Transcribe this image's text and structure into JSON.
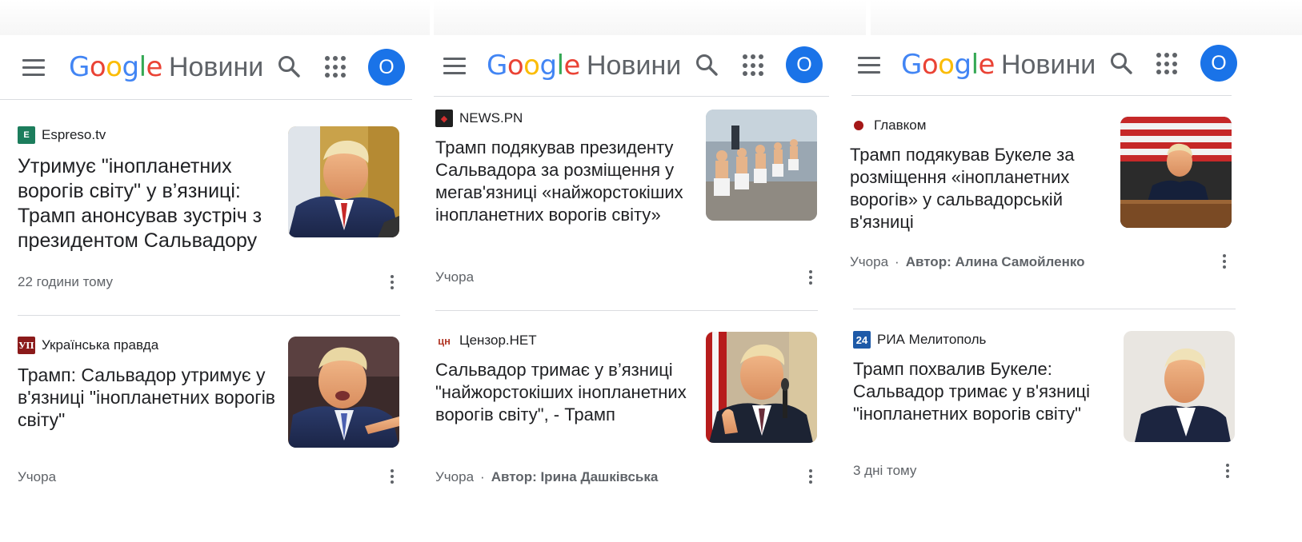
{
  "colors": {
    "g_blue": "#4285F4",
    "g_red": "#EA4335",
    "g_yellow": "#FBBC05",
    "g_green": "#34A853",
    "avatar": "#1a73e8",
    "text_primary": "#202124",
    "text_secondary": "#5f6368",
    "divider": "#dadce0"
  },
  "app": {
    "logo_letters": [
      "G",
      "o",
      "o",
      "g",
      "l",
      "e"
    ],
    "product": "Новини",
    "avatar_letter": "O",
    "icons": [
      "menu-icon",
      "search-icon",
      "apps-grid-icon"
    ]
  },
  "panels": [
    {
      "articles": [
        {
          "source": "Espreso.tv",
          "source_icon": "espreso-logo-icon",
          "headline": "Утримує \"інопланетних ворогів світу\" у в’язниці: Трамп анонсував зустріч з президентом Сальвадору",
          "time": "22 години тому",
          "author": "",
          "image": "donald-trump-photo"
        },
        {
          "source": "Українська правда",
          "source_icon": "pravda-logo-icon",
          "headline": "Трамп: Сальвадор утримує у в'язниці \"інопланетних ворогів світу\"",
          "time": "Учора",
          "author": "",
          "image": "donald-trump-photo"
        }
      ]
    },
    {
      "articles": [
        {
          "source": "NEWS.PN",
          "source_icon": "newspn-logo-icon",
          "headline": "Трамп подякував президенту Сальвадора за розміщення у мегав'язниці «найжорстокіших інопланетних ворогів світу»",
          "time": "Учора",
          "author": "",
          "image": "prisoners-photo"
        },
        {
          "source": "Цензор.НЕТ",
          "source_icon": "censor-logo-icon",
          "headline": "Сальвадор тримає у в’язниці \"найжорстокіших інопланетних ворогів світу\", - Трамп",
          "time": "Учора",
          "author": "Автор: Ірина Дашківська",
          "image": "donald-trump-photo"
        }
      ]
    },
    {
      "articles": [
        {
          "source": "Главком",
          "source_icon": "glavcom-dot-icon",
          "headline": "Трамп подякував Букеле за розміщення «інопланетних ворогів» у сальвадорській в'язниці",
          "time": "Учора",
          "author": "Автор: Алина Самойленко",
          "image": "donald-trump-speech-photo"
        },
        {
          "source": "РИА Мелитополь",
          "source_icon": "ria-logo-icon",
          "headline": "Трамп похвалив Букеле: Сальвадор тримає у в'язниці \"інопланетних ворогів світу\"",
          "time": "3 дні тому",
          "author": "",
          "image": "donald-trump-photo"
        }
      ]
    }
  ]
}
